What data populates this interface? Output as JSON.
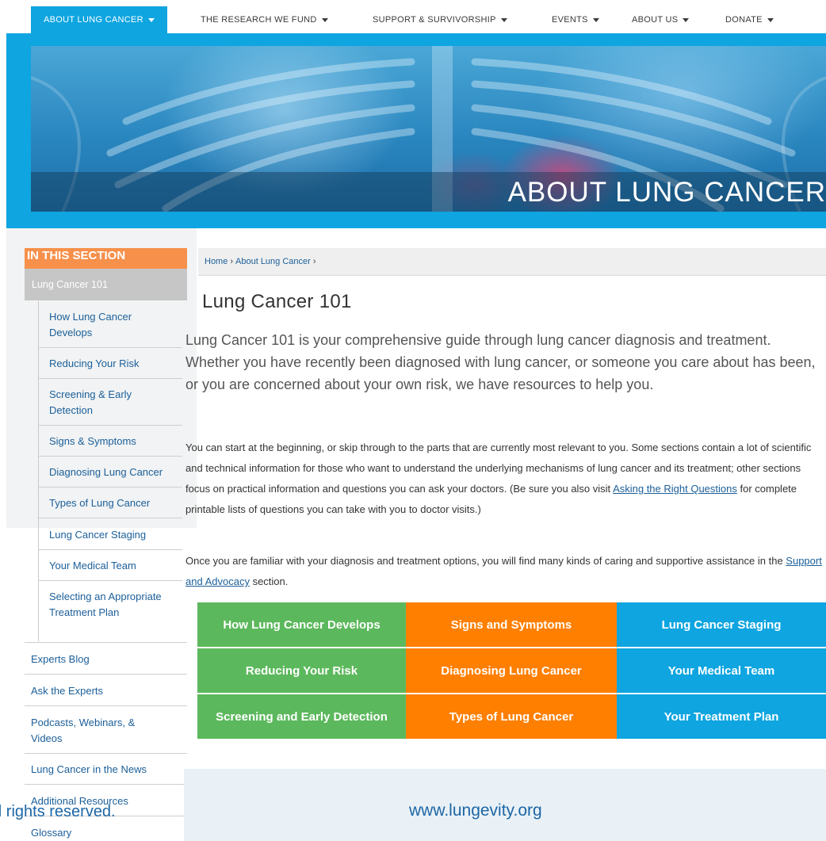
{
  "nav": {
    "items": [
      {
        "label": "ABOUT LUNG CANCER"
      },
      {
        "label": "THE RESEARCH WE FUND"
      },
      {
        "label": "SUPPORT & SURVIVORSHIP"
      },
      {
        "label": "EVENTS"
      },
      {
        "label": "ABOUT US"
      },
      {
        "label": "DONATE"
      }
    ]
  },
  "hero": {
    "title": "ABOUT LUNG CANCER"
  },
  "sidebar": {
    "heading": "IN THIS SECTION",
    "current": "Lung Cancer 101",
    "sub_items": [
      {
        "label": "How Lung Cancer Develops"
      },
      {
        "label": "Reducing Your Risk"
      },
      {
        "label": "Screening & Early Detection"
      },
      {
        "label": "Signs & Symptoms"
      },
      {
        "label": "Diagnosing Lung Cancer"
      },
      {
        "label": "Types of Lung Cancer"
      },
      {
        "label": "Lung Cancer Staging"
      },
      {
        "label": "Your Medical Team"
      },
      {
        "label": "Selecting an Appropriate Treatment Plan"
      }
    ],
    "main_items": [
      {
        "label": "Experts Blog"
      },
      {
        "label": "Ask the Experts"
      },
      {
        "label": "Podcasts, Webinars, & Videos"
      },
      {
        "label": "Lung Cancer in the News"
      },
      {
        "label": "Additional Resources"
      },
      {
        "label": "Glossary"
      }
    ]
  },
  "breadcrumb": {
    "home": "Home",
    "section": "About Lung Cancer",
    "separator": "›"
  },
  "content": {
    "title": "Lung Cancer 101",
    "lead": "Lung Cancer 101 is your comprehensive guide through lung cancer diagnosis and treatment. Whether you have recently been diagnosed with lung cancer, or someone you care about has been, or you are concerned about your own risk, we have resources to help you.",
    "para1_before": "You can start at the beginning, or skip through to the parts that are currently most relevant to you. Some sections contain a lot of scientific and technical information for those who want to understand the underlying mechanisms of lung cancer and its treatment; other sections focus on practical information and questions you can ask your doctors. (Be sure you also visit ",
    "para1_link": "Asking the Right Questions",
    "para1_after": " for complete printable lists of questions you can take with you to doctor visits.)",
    "para2_before": "Once you are familiar with your diagnosis and treatment options, you will find many kinds of caring and supportive assistance in the ",
    "para2_link": "Support and Advocacy",
    "para2_after": " section."
  },
  "tiles": [
    {
      "label": "How Lung Cancer Develops",
      "color": "green"
    },
    {
      "label": "Signs and Symptoms",
      "color": "orange"
    },
    {
      "label": "Lung Cancer Staging",
      "color": "blue"
    },
    {
      "label": "Reducing Your Risk",
      "color": "green"
    },
    {
      "label": "Diagnosing Lung Cancer",
      "color": "orange"
    },
    {
      "label": "Your Medical Team",
      "color": "blue"
    },
    {
      "label": "Screening and Early Detection",
      "color": "green"
    },
    {
      "label": "Types of Lung Cancer",
      "color": "orange"
    },
    {
      "label": "Your Treatment Plan",
      "color": "blue"
    }
  ],
  "footer": {
    "url": "www.lungevity.org",
    "rights": "All rights reserved."
  },
  "colors": {
    "accent_blue": "#0ea5e0",
    "sidebar_orange": "#f7904b",
    "tile_green": "#5cb85c",
    "tile_orange": "#ff7f00",
    "link_blue": "#1c5f99"
  }
}
